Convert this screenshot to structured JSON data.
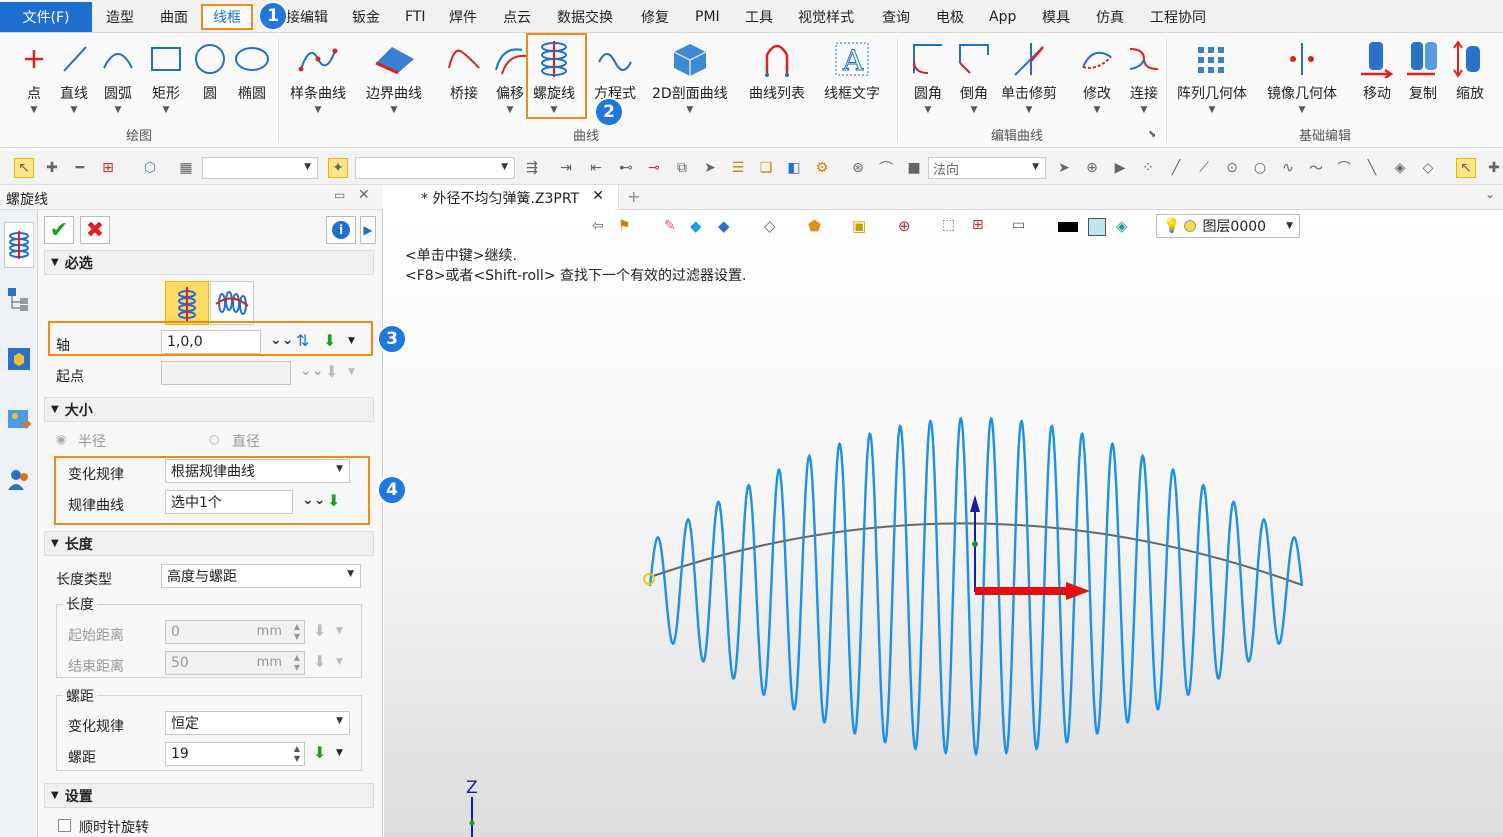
{
  "menu": {
    "file": "文件(F)",
    "items": [
      "造型",
      "曲面",
      "线框",
      "直接编辑",
      "钣金",
      "FTI",
      "焊件",
      "点云",
      "数据交换",
      "修复",
      "PMI",
      "工具",
      "视觉样式",
      "查询",
      "电极",
      "App",
      "模具",
      "仿真",
      "工程协同"
    ],
    "direct_edit_visible": "接编辑"
  },
  "badges": {
    "b1": "1",
    "b2": "2",
    "b3": "3",
    "b4": "4"
  },
  "ribbon": {
    "draw": {
      "label": "绘图",
      "items": [
        "点",
        "直线",
        "圆弧",
        "矩形",
        "圆",
        "椭圆"
      ]
    },
    "curve": {
      "label": "曲线",
      "items": [
        "样条曲线",
        "边界曲线",
        "桥接",
        "偏移",
        "螺旋线",
        "方程式",
        "2D剖面曲线",
        "曲线列表",
        "线框文字"
      ]
    },
    "edit_curve": {
      "label": "编辑曲线",
      "items": [
        "圆角",
        "倒角",
        "单击修剪",
        "修改",
        "连接"
      ]
    },
    "basic_edit": {
      "label": "基础编辑",
      "items": [
        "阵列几何体",
        "镜像几何体",
        "移动",
        "复制",
        "缩放"
      ]
    }
  },
  "toolbar2": {
    "direction": "法向"
  },
  "panel": {
    "title": "螺旋线",
    "required": {
      "header": "必选",
      "axis_label": "轴",
      "axis_value": "1,0,0",
      "start_label": "起点",
      "start_value": ""
    },
    "size": {
      "header": "大小",
      "radius": "半径",
      "diameter": "直径",
      "rule_label": "变化规律",
      "rule_value": "根据规律曲线",
      "curve_label": "规律曲线",
      "curve_value": "选中1个"
    },
    "length": {
      "header": "长度",
      "type_label": "长度类型",
      "type_value": "高度与螺距",
      "group_len": "长度",
      "start_dist_label": "起始距离",
      "start_dist_value": "0",
      "end_dist_label": "结束距离",
      "end_dist_value": "50",
      "unit": "mm",
      "group_pitch": "螺距",
      "pitch_rule_label": "变化规律",
      "pitch_rule_value": "恒定",
      "pitch_label": "螺距",
      "pitch_value": "19"
    },
    "settings": {
      "header": "设置",
      "clockwise": "顺时针旋转"
    }
  },
  "viewport": {
    "tab": "* 外径不均匀弹簧.Z3PRT",
    "msg1": "<单击中键>继续.",
    "msg2": "<F8>或者<Shift-roll> 查找下一个有效的过滤器设置.",
    "layer": "图层0000",
    "axis_label": "Z"
  },
  "colors": {
    "accent": "#1f6fd0",
    "highlight": "#f28a18",
    "helix": "#1e90e8"
  }
}
